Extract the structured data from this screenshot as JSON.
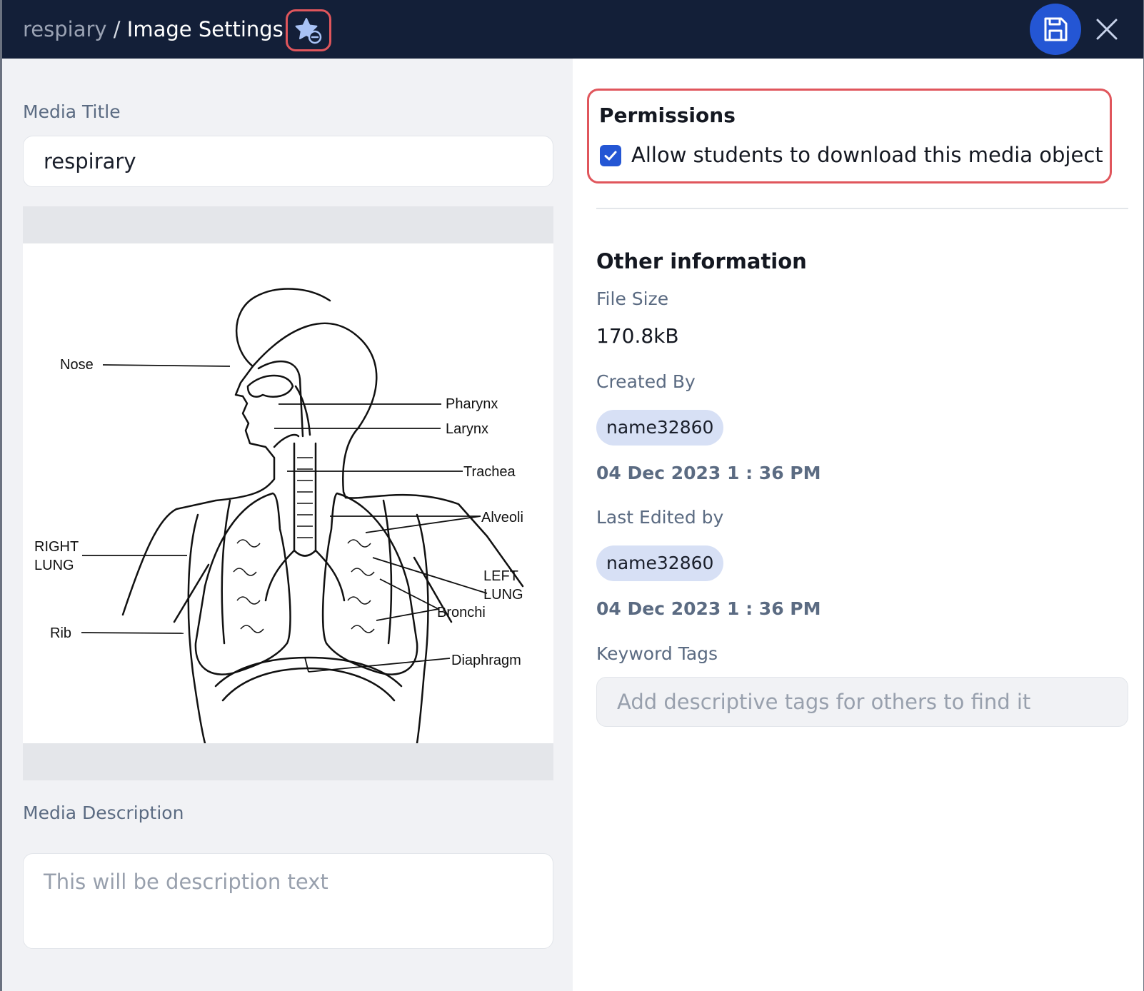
{
  "header": {
    "breadcrumb_parent": "respiary",
    "breadcrumb_separator": " / ",
    "breadcrumb_current": "Image Settings",
    "favorite_icon": "star-remove-icon",
    "save_icon": "floppy-disk-icon",
    "close_icon": "close-icon"
  },
  "media": {
    "title_label": "Media Title",
    "title_value": "respirary",
    "description_label": "Media Description",
    "description_placeholder": "This will be description text",
    "image_labels": {
      "nose": "Nose",
      "pharynx": "Pharynx",
      "larynx": "Larynx",
      "trachea": "Trachea",
      "alveoli": "Alveoli",
      "right_lung_1": "RIGHT",
      "right_lung_2": "LUNG",
      "left_lung_1": "LEFT",
      "left_lung_2": "LUNG",
      "bronchi": "Bronchi",
      "rib": "Rib",
      "diaphragm": "Diaphragm"
    }
  },
  "permissions": {
    "title": "Permissions",
    "allow_download_label": "Allow students to download this media object",
    "allow_download_checked": true
  },
  "info": {
    "title": "Other information",
    "file_size_label": "File Size",
    "file_size_value": "170.8kB",
    "created_by_label": "Created By",
    "created_by_user": "name32860",
    "created_date": "04 Dec 2023 1 : 36 PM",
    "last_edited_label": "Last Edited by",
    "last_edited_user": "name32860",
    "last_edited_date": "04 Dec 2023 1 : 36 PM",
    "keyword_tags_label": "Keyword Tags",
    "keyword_tags_placeholder": "Add descriptive tags for others to find it"
  },
  "colors": {
    "header_bg": "#131f38",
    "accent": "#2456d4",
    "highlight_border": "#e0565c",
    "chip_bg": "#d7e0f5"
  }
}
